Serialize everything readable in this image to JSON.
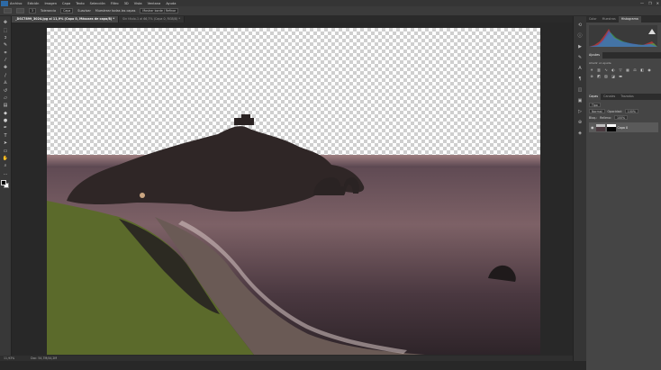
{
  "app": {
    "logo": "Ps"
  },
  "menu": [
    "Archivo",
    "Edición",
    "Imagen",
    "Capa",
    "Texto",
    "Selección",
    "Filtro",
    "3D",
    "Vista",
    "Ventana",
    "Ayuda"
  ],
  "window_controls": [
    "—",
    "❐",
    "✕"
  ],
  "options_bar": {
    "size_value": "3",
    "mode_label": "Tolerancia",
    "mode_value": "Capa",
    "checkbox_label": "Suavizar",
    "refine_label": "Mostrar borde / Refinar",
    "extra_label": "Muestrear todas las capas"
  },
  "tabs": [
    {
      "label": "_DSC7899_3024.jpg al 11,9% (Capa 0, Máscara de capa/8) *",
      "active": true
    },
    {
      "label": "Sin título-1 al 66,7% (Capa 0, RGB/8) *",
      "active": false
    }
  ],
  "tools": [
    "move",
    "marquee",
    "lasso",
    "quick-select",
    "crop",
    "eyedropper",
    "healing",
    "brush",
    "stamp",
    "history-brush",
    "eraser",
    "gradient",
    "blur",
    "dodge",
    "pen",
    "type",
    "path-select",
    "rectangle",
    "hand",
    "zoom",
    "more"
  ],
  "status_bar": {
    "zoom": "11,93%",
    "doc": "Doc: 54,7M/44,2M"
  },
  "panels": {
    "top_tabs": [
      {
        "label": "Color",
        "active": false
      },
      {
        "label": "Muestras",
        "active": false
      },
      {
        "label": "Histograma",
        "active": true
      }
    ],
    "adjust_tabs": [
      {
        "label": "Ajustes",
        "active": true
      }
    ],
    "adjust_hint": "Añadir un ajuste",
    "layers_tabs": [
      {
        "label": "Capas",
        "active": true
      },
      {
        "label": "Canales",
        "active": false
      },
      {
        "label": "Trazados",
        "active": false
      }
    ],
    "layers": {
      "filter_label": "Tipo",
      "blend_mode": "Normal",
      "opacity_label": "Opacidad:",
      "opacity_value": "100%",
      "lock_label": "Bloq.:",
      "fill_label": "Relleno:",
      "fill_value": "100%",
      "items": [
        {
          "name": "Capa 0"
        }
      ]
    }
  },
  "colors": {
    "sky_transparent": "#ffffff",
    "sea_dark": "#3a2a33",
    "sea_light": "#b08a8c",
    "island": "#2f2626",
    "grass": "#5b6a2b"
  }
}
